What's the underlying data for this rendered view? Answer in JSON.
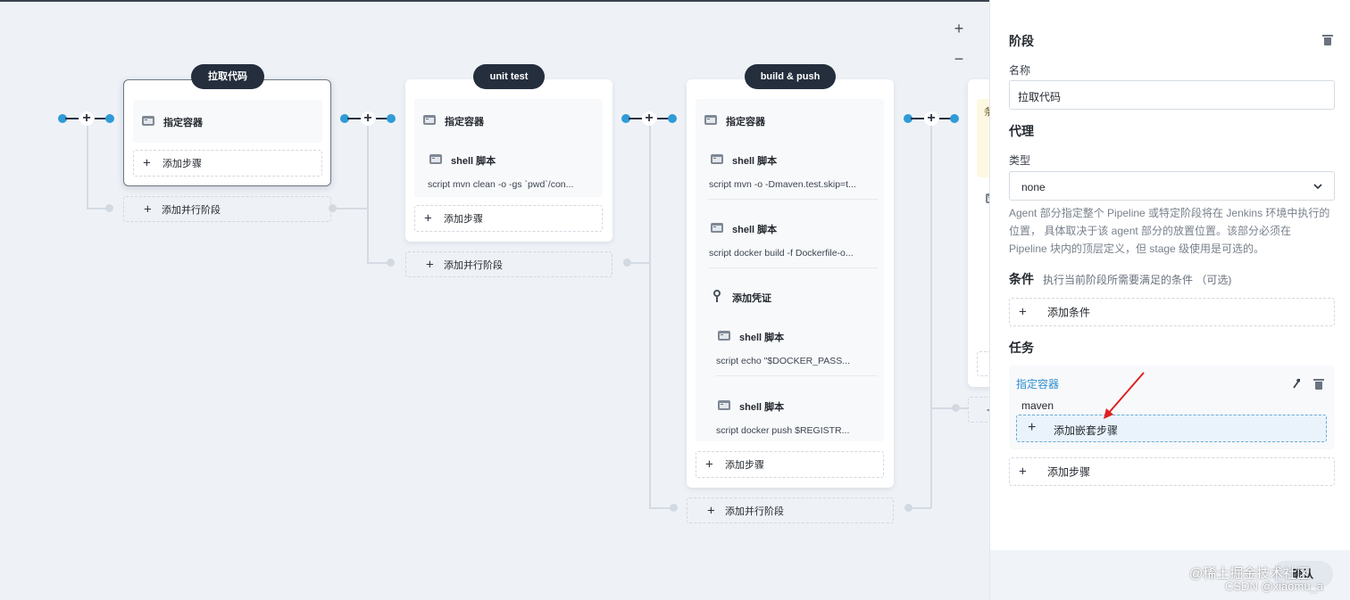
{
  "stages": {
    "s1": {
      "name": "拉取代码",
      "tasks": [
        {
          "title": "指定容器"
        }
      ],
      "add_step": "添加步骤",
      "add_parallel": "添加并行阶段"
    },
    "s2": {
      "name": "unit test",
      "tasks": [
        {
          "title": "指定容器"
        },
        {
          "title": "shell 脚本",
          "script": "script   mvn clean -o -gs `pwd`/con..."
        }
      ],
      "add_step": "添加步骤",
      "add_parallel": "添加并行阶段"
    },
    "s3": {
      "name": "build & push",
      "tasks": [
        {
          "title": "指定容器"
        },
        {
          "title": "shell 脚本",
          "script": "script   mvn -o -Dmaven.test.skip=t..."
        },
        {
          "title": "shell 脚本",
          "script": "script   docker build -f Dockerfile-o..."
        },
        {
          "title": "添加凭证"
        },
        {
          "title": "shell 脚本",
          "script": "script   echo \"$DOCKER_PASS..."
        },
        {
          "title": "shell 脚本",
          "script": "script   docker push $REGISTR..."
        }
      ],
      "add_step": "添加步骤",
      "add_parallel": "添加并行阶段"
    },
    "s4": {
      "partial_text": "条",
      "partial_dash": "-"
    }
  },
  "zoom": {
    "in": "+",
    "out": "−"
  },
  "panel": {
    "title": "阶段",
    "name_label": "名称",
    "name_value": "拉取代码",
    "agent_title": "代理",
    "type_label": "类型",
    "type_value": "none",
    "agent_desc_1": "Agent 部分指定整个 Pipeline 或特定阶段将在 Jenkins 环境中执行的",
    "agent_desc_2": "位置， 具体取决于该 agent 部分的放置位置。该部分必须在",
    "agent_desc_3": "Pipeline 块内的顶层定义，但 stage 级使用是可选的。",
    "condition_title": "条件",
    "condition_hint": "执行当前阶段所需要满足的条件 （可选)",
    "add_condition": "添加条件",
    "tasks_title": "任务",
    "container_task": {
      "title": "指定容器",
      "value": "maven",
      "add_nested": "添加嵌套步骤"
    },
    "add_step": "添加步骤",
    "ok": "确认"
  },
  "watermark": {
    "line1": "@稀土掘金技术社区",
    "line2": "CSDN @xiaomu_a"
  },
  "colors": {
    "accent": "#2f9bd7",
    "pill": "#242e3d",
    "annotation_arrow": "#e02020",
    "nested_bg": "#eaf3fb"
  }
}
